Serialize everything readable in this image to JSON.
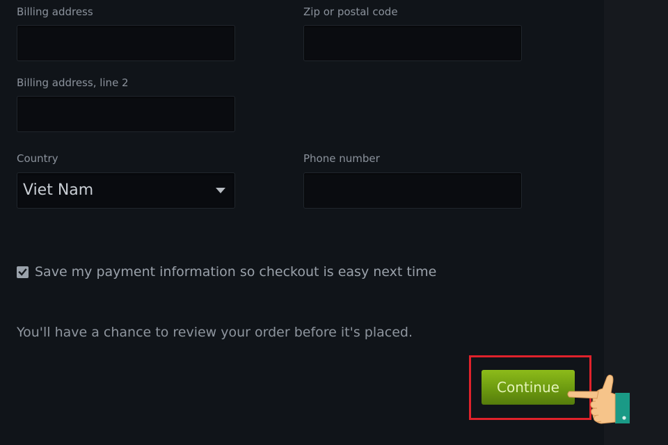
{
  "form": {
    "billing_address_label": "Billing address",
    "zip_label": "Zip or postal code",
    "billing_address_line2_label": "Billing address, line 2",
    "country_label": "Country",
    "country_value": "Viet Nam",
    "phone_label": "Phone number",
    "billing_address_value": "",
    "zip_value": "",
    "billing_address_line2_value": "",
    "phone_value": ""
  },
  "save_payment": {
    "checked": true,
    "label": "Save my payment information so checkout is easy next time"
  },
  "review_note": "You'll have a chance to review your order before it's placed.",
  "continue_label": "Continue",
  "icons": {
    "country_dropdown": "chevron-down-icon",
    "checkbox": "checkmark-icon",
    "pointer": "hand-pointer-icon"
  },
  "colors": {
    "background": "#101419",
    "button_green": "#6c9a10",
    "highlight_red": "#e0222b",
    "hand_skin": "#f6c48a",
    "cuff_teal": "#1a9a86"
  }
}
